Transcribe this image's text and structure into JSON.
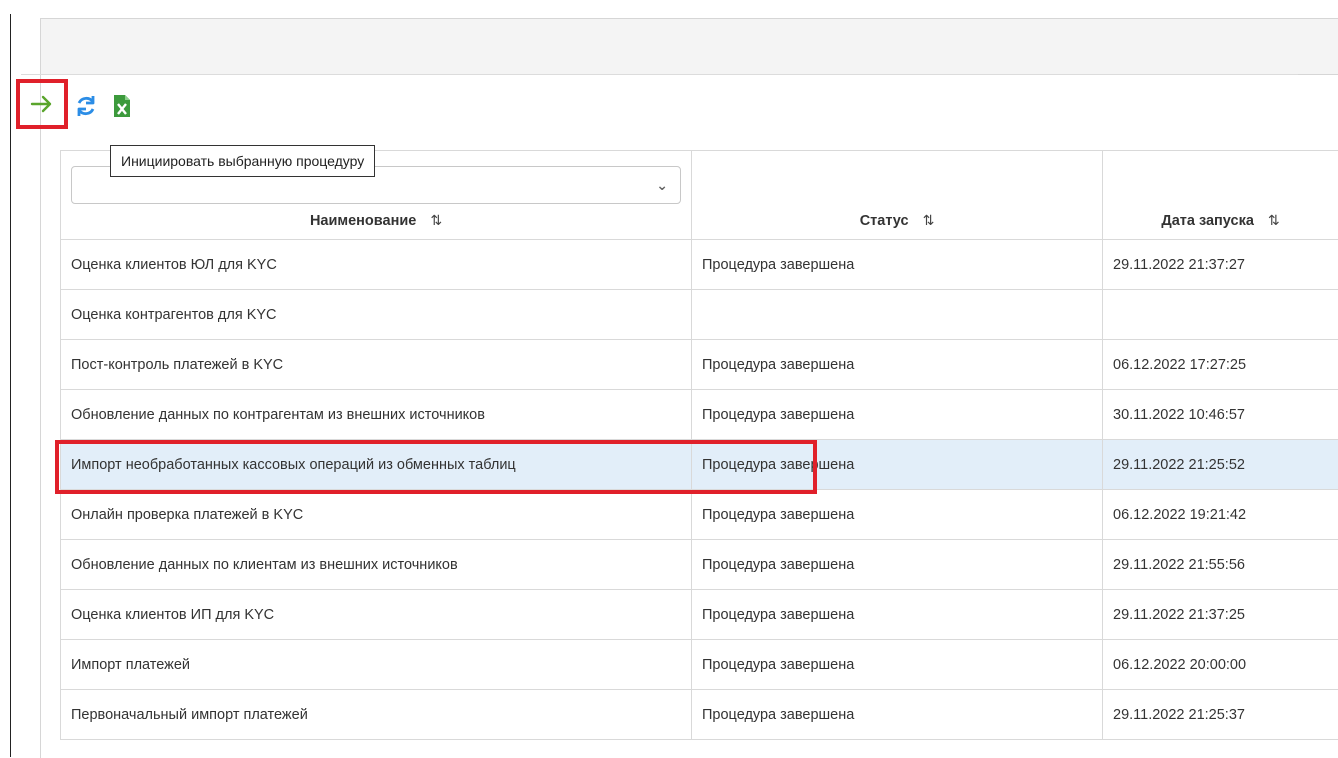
{
  "colors": {
    "accent_red": "#e0202a",
    "green_arrow": "#5aa52c",
    "refresh_blue": "#2b8de6",
    "excel_green": "#3c9a3c",
    "selected_row": "#e2eef9"
  },
  "toolbar": {
    "buttons": [
      {
        "icon": "arrow-right-icon"
      },
      {
        "icon": "refresh-icon"
      },
      {
        "icon": "excel-export-icon"
      }
    ],
    "tooltip": "Инициировать выбранную процедуру"
  },
  "table": {
    "columns": [
      {
        "label": "Наименование",
        "sort_icon": "⇅"
      },
      {
        "label": "Статус",
        "sort_icon": "⇅"
      },
      {
        "label": "Дата запуска",
        "sort_icon": "⇅"
      }
    ],
    "filter_chevron": "⌄",
    "rows": [
      {
        "name": "Оценка клиентов ЮЛ для KYC",
        "status": "Процедура завершена",
        "date": "29.11.2022 21:37:27"
      },
      {
        "name": "Оценка контрагентов для KYC",
        "status": "",
        "date": ""
      },
      {
        "name": "Пост-контроль платежей в KYC",
        "status": "Процедура завершена",
        "date": "06.12.2022 17:27:25"
      },
      {
        "name": "Обновление данных по контрагентам из внешних источников",
        "status": "Процедура завершена",
        "date": "30.11.2022 10:46:57"
      },
      {
        "name": "Импорт необработанных кассовых операций из обменных таблиц",
        "status": "Процедура завершена",
        "date": "29.11.2022 21:25:52"
      },
      {
        "name": "Онлайн проверка платежей в KYC",
        "status": "Процедура завершена",
        "date": "06.12.2022 19:21:42"
      },
      {
        "name": "Обновление данных по клиентам из внешних источников",
        "status": "Процедура завершена",
        "date": "29.11.2022 21:55:56"
      },
      {
        "name": "Оценка клиентов ИП для KYC",
        "status": "Процедура завершена",
        "date": "29.11.2022 21:37:25"
      },
      {
        "name": "Импорт платежей",
        "status": "Процедура завершена",
        "date": "06.12.2022 20:00:00"
      },
      {
        "name": "Первоначальный импорт платежей",
        "status": "Процедура завершена",
        "date": "29.11.2022 21:25:37"
      }
    ]
  }
}
